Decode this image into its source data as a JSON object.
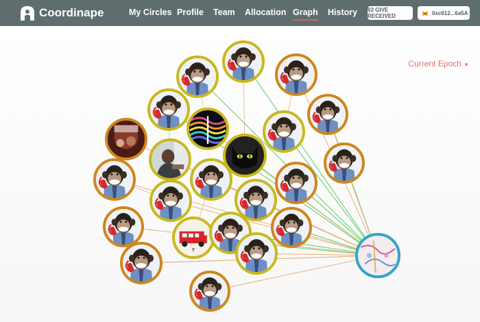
{
  "app": {
    "brand": "Coordinape",
    "logo_icon": "coordinape-logo-icon"
  },
  "nav": {
    "items": [
      {
        "label": "My Circles",
        "active": false
      },
      {
        "label": "Profile",
        "active": false
      },
      {
        "label": "Team",
        "active": false
      },
      {
        "label": "Allocation",
        "active": false
      },
      {
        "label": "Graph",
        "active": true
      },
      {
        "label": "History",
        "active": false
      }
    ]
  },
  "header": {
    "give_received": "63 GIVE RECEIVED",
    "wallet": "0xc612...6a5A",
    "wallet_icon": "metamask-fox-icon"
  },
  "graph": {
    "epoch_select": "Current Epoch",
    "colors": {
      "node_border_gold": "#c9b81c",
      "node_border_orange": "#d0861c",
      "node_border_blue": "#2fa6cd",
      "edge_orange": "#e8b079",
      "edge_green": "#6fd476"
    },
    "nodes": [
      {
        "avatar": "chimp",
        "ring": "gold"
      },
      {
        "avatar": "chimp",
        "ring": "orange"
      },
      {
        "avatar": "chimp",
        "ring": "orange"
      },
      {
        "avatar": "chimp",
        "ring": "gold"
      },
      {
        "avatar": "chimp",
        "ring": "orange"
      },
      {
        "avatar": "chimp",
        "ring": "gold"
      },
      {
        "avatar": "abstract-lines",
        "ring": "gold"
      },
      {
        "avatar": "photo-red",
        "ring": "orange"
      },
      {
        "avatar": "chimp",
        "ring": "gold"
      },
      {
        "avatar": "chimp",
        "ring": "orange"
      },
      {
        "avatar": "photo-person",
        "ring": "gold"
      },
      {
        "avatar": "black-cat",
        "ring": "gold"
      },
      {
        "avatar": "chimp",
        "ring": "orange"
      },
      {
        "avatar": "chimp",
        "ring": "orange"
      },
      {
        "avatar": "chimp",
        "ring": "gold"
      },
      {
        "avatar": "chimp",
        "ring": "gold"
      },
      {
        "avatar": "chimp",
        "ring": "gold"
      },
      {
        "avatar": "chimp",
        "ring": "gold"
      },
      {
        "avatar": "chimp",
        "ring": "orange"
      },
      {
        "avatar": "red-car",
        "ring": "gold"
      },
      {
        "avatar": "chimp",
        "ring": "gold"
      },
      {
        "avatar": "chimp",
        "ring": "gold"
      },
      {
        "avatar": "chimp",
        "ring": "orange"
      },
      {
        "avatar": "chimp",
        "ring": "gold"
      },
      {
        "avatar": "chimp",
        "ring": "orange"
      },
      {
        "avatar": "sketch-map",
        "ring": "blue"
      }
    ]
  }
}
